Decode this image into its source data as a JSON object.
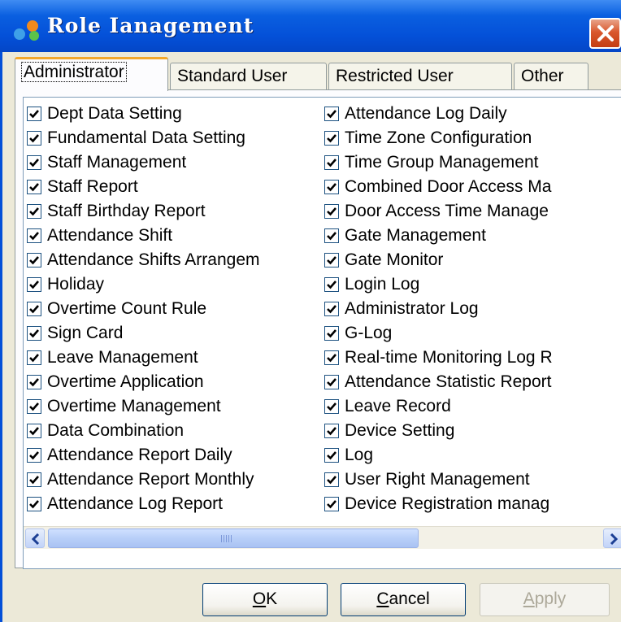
{
  "window": {
    "title": "Role Ianagement"
  },
  "tabs": [
    {
      "label": "Administrator",
      "active": true
    },
    {
      "label": "Standard User",
      "active": false
    },
    {
      "label": "Restricted User",
      "active": false
    },
    {
      "label": "Other",
      "active": false
    }
  ],
  "permissions_col1": [
    "Dept Data Setting",
    "Fundamental Data Setting",
    "Staff Management",
    "Staff Report",
    "Staff Birthday Report",
    "Attendance Shift",
    "Attendance Shifts Arrangem",
    "Holiday",
    "Overtime Count Rule",
    "Sign Card",
    "Leave Management",
    "Overtime Application",
    "Overtime Management",
    "Data Combination",
    "Attendance Report Daily",
    "Attendance Report Monthly",
    "Attendance Log Report"
  ],
  "permissions_col2": [
    "Attendance Log Daily",
    "Time Zone Configuration",
    "Time Group Management",
    "Combined Door Access Ma",
    "Door Access Time Manage",
    "Gate Management",
    "Gate Monitor",
    "Login Log",
    "Administrator Log",
    "G-Log",
    "Real-time Monitoring Log R",
    "Attendance Statistic Report",
    "Leave Record",
    "Device Setting",
    "Log",
    "User Right Management",
    "Device Registration manag"
  ],
  "all_checked": true,
  "buttons": {
    "ok": {
      "mnemonic": "O",
      "rest": "K"
    },
    "cancel": {
      "mnemonic": "C",
      "rest": "ancel"
    },
    "apply": {
      "mnemonic": "A",
      "rest": "pply",
      "enabled": false
    }
  },
  "colors": {
    "titlebar": "#0450d8",
    "close": "#d9582e",
    "tab_highlight": "#f4a82b"
  }
}
